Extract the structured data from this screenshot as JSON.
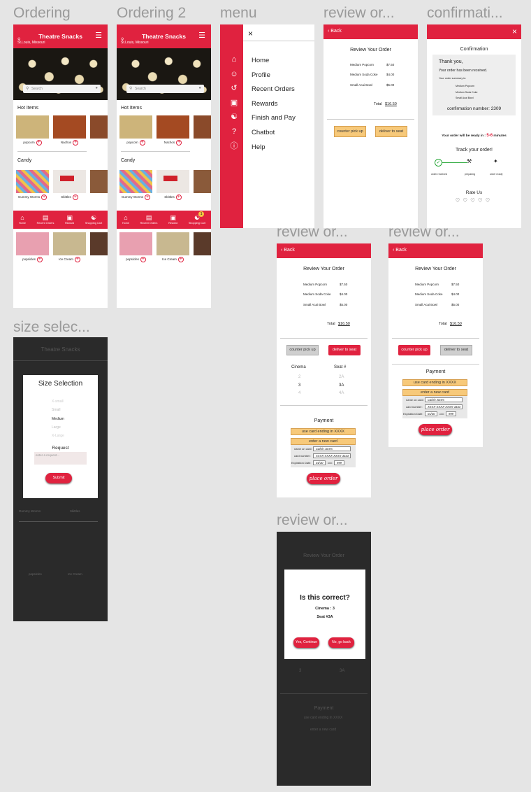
{
  "frames": {
    "ordering": "Ordering",
    "ordering2": "Ordering 2",
    "menu": "menu",
    "review1": "review or...",
    "confirmation": "confirmati...",
    "review2": "review or...",
    "review3": "review or...",
    "size": "size selec...",
    "review4": "review or..."
  },
  "app": {
    "title": "Theatre Snacks",
    "location": "St.Louis, Missouri",
    "search_placeholder": "Search",
    "hot_items": "Hot Items",
    "candy": "Candy",
    "hot": [
      {
        "name": "popcorn",
        "color": "#c9b27a"
      },
      {
        "name": "Nachos",
        "color": "#a44a22"
      },
      {
        "name": "",
        "color": "#8a4a2a"
      }
    ],
    "candy_items": [
      {
        "name": "Gummy Worms",
        "color": "#d86a8a"
      },
      {
        "name": "Skittles",
        "color": "#e9e4e0"
      },
      {
        "name": "",
        "color": "#8a5a3a"
      }
    ],
    "more_items": [
      {
        "name": "popsicles",
        "color": "#e8a0b0"
      },
      {
        "name": "Ice Cream",
        "color": "#c8b890"
      },
      {
        "name": "",
        "color": "#5a3a2a"
      }
    ],
    "nav": [
      "Home",
      "Recent Orders",
      "Reward",
      "Shopping Cart"
    ],
    "nav2": [
      "Home",
      "Recent Orders",
      "Reward",
      "Shopping Cart"
    ],
    "cart_badge": "1"
  },
  "menu": {
    "close": "×",
    "items": [
      "Home",
      "Profile",
      "Recent Orders",
      "Rewards",
      "Finish and Pay",
      "Chatbot",
      "Help"
    ]
  },
  "review": {
    "back": "Back",
    "title": "Review Your Order",
    "lines": [
      {
        "name": "Medium Popcorn",
        "price": "$7.50"
      },
      {
        "name": "Medium Soda Coke",
        "price": "$4.00"
      },
      {
        "name": "Small Acai Bowl",
        "price": "$5.00"
      }
    ],
    "total_label": "Total",
    "total": "$16.50",
    "counter": "counter pick up",
    "deliver": "deliver to seat",
    "cinema_label": "Cinema",
    "seat_label": "Seat #",
    "cinemas": [
      "2",
      "3",
      "4"
    ],
    "seats": [
      "2A",
      "3A",
      "4A"
    ],
    "payment": "Payment",
    "use_card": "use card ending in XXXX",
    "new_card": "enter a new card",
    "name_label": "name on card:",
    "name_value": "Calvin Jones",
    "number_label": "card number:",
    "number_value": "XXXX-XXXX-XXXX-3333",
    "exp_label": "Expiration Date:",
    "exp_value": "01/30",
    "cvv_label": "cvv:",
    "cvv_value": "999",
    "place_order": "place order"
  },
  "confirm": {
    "title": "Confirmation",
    "thanks": "Thank you,",
    "received": "Your order has been received.",
    "summary": "Your order summary is:",
    "items": [
      "Medium Popcorn",
      "Medium Soda Coke",
      "Small Acai Bowl"
    ],
    "number": "confirmation number: 2309",
    "ready_pre": "Your order will be ready in : ",
    "ready_mins": "5-6",
    "ready_post": " minutes",
    "track": "Track your order!",
    "steps": [
      "order received",
      "preparing",
      "order ready"
    ],
    "rate": "Rate Us"
  },
  "size": {
    "title": "Size Selection",
    "options": [
      "X-small",
      "Small",
      "Medium",
      "Large",
      "X-Large"
    ],
    "request_label": "Request",
    "request_placeholder": "enter a request...",
    "submit": "Submit",
    "bg_title": "Theatre Snacks",
    "bg_gummy": "Gummy Worms",
    "bg_skittles": "Skittles",
    "bg_popsicles": "popsicles",
    "bg_ice": "Ice Cream"
  },
  "modal": {
    "question": "Is this correct?",
    "cinema": "Cinema : 3",
    "seat": "Seat #3A",
    "yes": "Yes, Continue",
    "no": "No, go back",
    "bg_title": "Review Your Order",
    "bg_payment": "Payment",
    "bg_use_card": "use card ending in XXXX",
    "bg_new_card": "enter a new card",
    "bg_cinema": "3",
    "bg_seat": "3A"
  }
}
